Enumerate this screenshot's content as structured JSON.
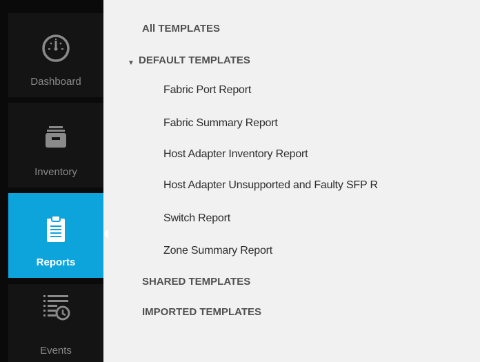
{
  "sidebar": {
    "items": [
      {
        "label": "Dashboard",
        "icon": "speedometer-icon"
      },
      {
        "label": "Inventory",
        "icon": "inventory-box-icon"
      },
      {
        "label": "Reports",
        "icon": "clipboard-icon",
        "selected": true
      },
      {
        "label": "Events",
        "icon": "event-list-clock-icon"
      }
    ]
  },
  "templates": {
    "all": "All TEMPLATES",
    "default": {
      "label": "DEFAULT TEMPLATES",
      "expand_glyph": "▼",
      "items": [
        "Fabric Port Report",
        "Fabric Summary Report",
        "Host Adapter Inventory Report",
        "Host Adapter Unsupported and Faulty SFP R",
        "Switch Report",
        "Zone Summary Report"
      ]
    },
    "shared": "SHARED TEMPLATES",
    "imported": "IMPORTED TEMPLATES"
  },
  "colors": {
    "selected_nav": "#0da4db",
    "nav_bg": "#141414",
    "panel_bg": "#f1f1f1"
  }
}
